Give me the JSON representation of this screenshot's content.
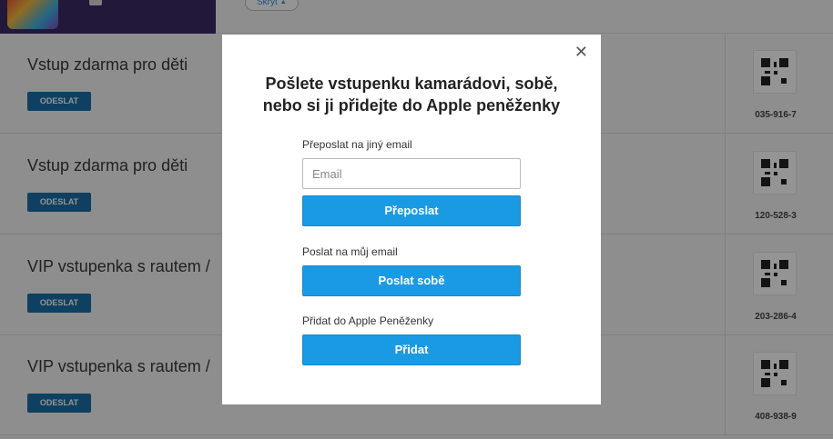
{
  "header": {
    "hide_label": "Skrýt",
    "hide_icon": "triangle-up-icon"
  },
  "tickets": [
    {
      "title": "Vstup zdarma pro děti",
      "send_label": "ODESLAT",
      "code": "035-916-7"
    },
    {
      "title": "Vstup zdarma pro děti",
      "send_label": "ODESLAT",
      "code": "120-528-3"
    },
    {
      "title": "VIP vstupenka s rautem / ",
      "send_label": "ODESLAT",
      "code": "203-286-4"
    },
    {
      "title": "VIP vstupenka s rautem / ",
      "send_label": "ODESLAT",
      "code": "408-938-9"
    }
  ],
  "modal": {
    "close_icon": "close-icon",
    "title_line1": "Pošlete vstupenku kamarádovi, sobě,",
    "title_line2": "nebo si ji přidejte do Apple peněženky",
    "forward_label": "Přeposlat na jiný email",
    "email_placeholder": "Email",
    "forward_button": "Přeposlat",
    "self_label": "Poslat na můj email",
    "self_button": "Poslat sobě",
    "wallet_label": "Přidat do Apple Peněženky",
    "wallet_button": "Přidat"
  },
  "colors": {
    "primary_button": "#1b9ae4",
    "send_button": "#1a6fa8",
    "header_thumb": "#3c2a63"
  }
}
